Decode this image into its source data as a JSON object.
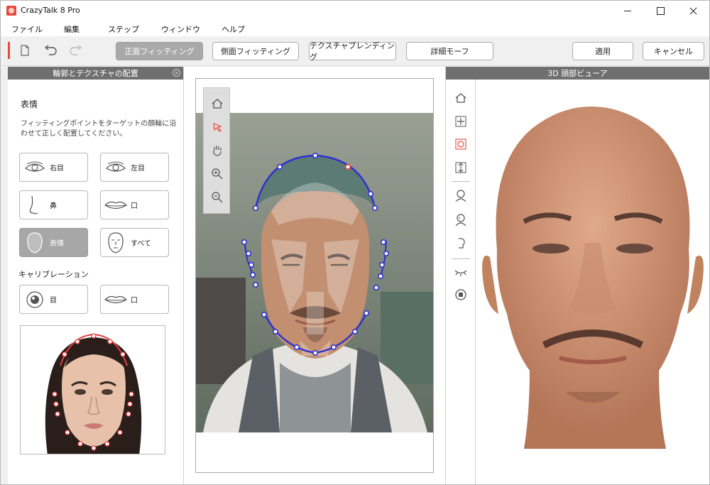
{
  "app": {
    "title": "CrazyTalk 8 Pro"
  },
  "menu": [
    "ファイル",
    "編集",
    "ステップ",
    "ウィンドウ",
    "ヘルプ"
  ],
  "toolbar": {
    "tabs": [
      "正面フィッティング",
      "側面フィッティング",
      "テクスチャブレンディング",
      "詳細モーフ"
    ],
    "apply_label": "適用",
    "cancel_label": "キャンセル"
  },
  "left_panel": {
    "header": "輪郭とテクスチャの配置",
    "expression_title": "表情",
    "description": "フィッティングポイントをターゲットの顔輪に沿わせて正しく配置してください。",
    "buttons": [
      "右目",
      "左目",
      "鼻",
      "口",
      "表情",
      "すべて"
    ],
    "calibration_title": "キャリブレーション",
    "calibration_buttons": [
      "目",
      "口"
    ]
  },
  "viewer": {
    "header": "3D 頭部ビューア"
  },
  "colors": {
    "accent": "#e8493f",
    "header_bg": "#6f6f6f",
    "active_tab": "#a9a9a9",
    "fit_line": "#2f2fd0"
  },
  "icons": {
    "toolbar": [
      "new-file-icon",
      "undo-icon",
      "redo-icon"
    ],
    "fit_tools": [
      "home-icon",
      "select-arrow-icon",
      "pan-hand-icon",
      "zoom-in-icon",
      "zoom-out-icon"
    ],
    "viewer_tools": [
      "home-icon",
      "move-icon",
      "rotate-icon",
      "zoom-vertical-icon",
      "head-front-icon",
      "head-side-icon",
      "head-profile-icon",
      "eye-blink-icon",
      "reset-icon"
    ]
  }
}
